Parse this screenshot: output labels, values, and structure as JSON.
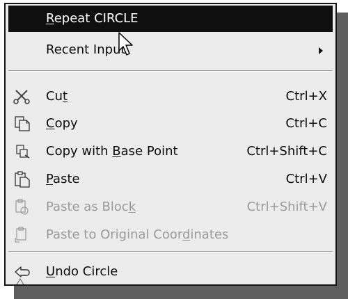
{
  "context_menu": {
    "items": [
      {
        "label": "Repeat CIRCLE",
        "underline": "R",
        "shortcut": "",
        "state": "highlighted"
      },
      {
        "label": "Recent Input",
        "underline": "",
        "shortcut": "",
        "state": "normal",
        "submenu": true
      },
      {
        "label": "Cut",
        "underline": "t",
        "shortcut": "Ctrl+X",
        "state": "normal",
        "icon": "cut-icon"
      },
      {
        "label": "Copy",
        "underline": "C",
        "shortcut": "Ctrl+C",
        "state": "normal",
        "icon": "copy-icon"
      },
      {
        "label": "Copy with Base Point",
        "underline": "B",
        "shortcut": "Ctrl+Shift+C",
        "state": "normal",
        "icon": "copy-base-point-icon"
      },
      {
        "label": "Paste",
        "underline": "P",
        "shortcut": "Ctrl+V",
        "state": "normal",
        "icon": "paste-icon"
      },
      {
        "label": "Paste as Block",
        "underline": "k",
        "shortcut": "Ctrl+Shift+V",
        "state": "disabled",
        "icon": "paste-as-block-icon"
      },
      {
        "label": "Paste to Original Coordinates",
        "underline": "d",
        "shortcut": "",
        "state": "disabled",
        "icon": "paste-to-original-coordinates-icon"
      },
      {
        "label": "Undo Circle",
        "underline": "U",
        "shortcut": "",
        "state": "normal",
        "icon": "undo-icon"
      }
    ]
  },
  "colors": {
    "highlight_bg": "#0f0f0f",
    "menu_bg": "#ececec",
    "disabled_text": "#9a9a9a"
  }
}
